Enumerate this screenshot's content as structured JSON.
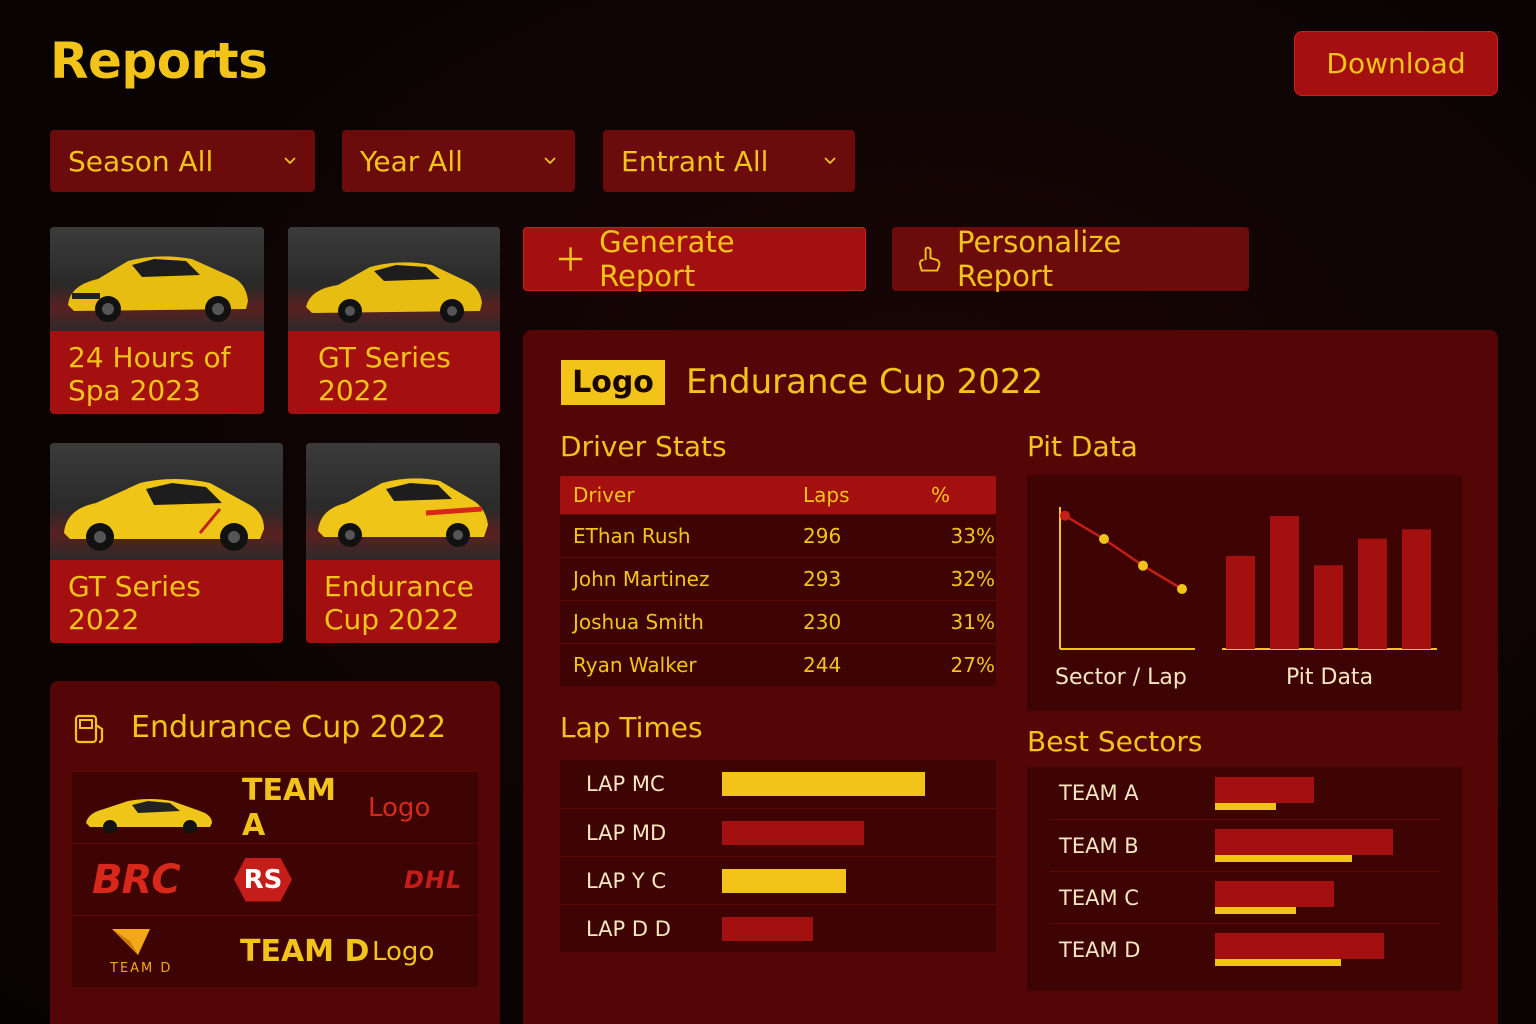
{
  "page": {
    "title": "Reports"
  },
  "header": {
    "download_label": "Download"
  },
  "filters": [
    {
      "label": "Season All"
    },
    {
      "label": "Year All"
    },
    {
      "label": "Entrant All"
    }
  ],
  "cards": [
    {
      "title": "24 Hours of Spa 2023"
    },
    {
      "title": "GT Series 2022"
    },
    {
      "title": "GT Series 2022"
    },
    {
      "title": "Endurance Cup 2022"
    }
  ],
  "actions": {
    "generate_label": "Generate Report",
    "personalize_label": "Personalize Report"
  },
  "report": {
    "logo_text": "Logo",
    "title": "Endurance Cup 2022",
    "driver_stats": {
      "heading": "Driver Stats",
      "columns": [
        "Driver",
        "Laps",
        "%"
      ],
      "rows": [
        {
          "driver": "EThan Rush",
          "laps": "296",
          "pct": "33%"
        },
        {
          "driver": "John Martinez",
          "laps": "293",
          "pct": "32%"
        },
        {
          "driver": "Joshua Smith",
          "laps": "230",
          "pct": "31%"
        },
        {
          "driver": "Ryan Walker",
          "laps": "244",
          "pct": "27%"
        }
      ]
    },
    "pit_data": {
      "heading": "Pit Data",
      "line_label": "Sector / Lap",
      "bar_label": "Pit Data",
      "line_values": [
        4,
        3.3,
        2.5,
        1.8
      ],
      "bar_values": [
        0.7,
        1.0,
        0.63,
        0.83,
        0.9
      ]
    },
    "lap_times": {
      "heading": "Lap Times",
      "rows": [
        {
          "label": "LAP MC",
          "value": 1.0,
          "color": "#f2c318"
        },
        {
          "label": "LAP MD",
          "value": 0.7,
          "color": "#a3100f"
        },
        {
          "label": "LAP Y C",
          "value": 0.61,
          "color": "#f2c318"
        },
        {
          "label": "LAP D D",
          "value": 0.45,
          "color": "#a3100f"
        }
      ]
    },
    "best_sectors": {
      "heading": "Best Sectors",
      "rows": [
        {
          "label": "TEAM A",
          "red": 0.55,
          "yellow": 0.34
        },
        {
          "label": "TEAM B",
          "red": 0.99,
          "yellow": 0.76
        },
        {
          "label": "TEAM C",
          "red": 0.66,
          "yellow": 0.45
        },
        {
          "label": "TEAM D",
          "red": 0.94,
          "yellow": 0.7
        }
      ]
    }
  },
  "entrants_panel": {
    "title": "Endurance Cup 2022",
    "team_a": "TEAM A",
    "team_a_logo": "Logo",
    "brc": "BRC",
    "rs": "RS",
    "dhl": "DHL",
    "team_d_mark": "TEAM D",
    "team_d": "TEAM D",
    "team_d_logo": "Logo"
  },
  "colors": {
    "accent": "#f2c318",
    "brand_red": "#a3100f",
    "panel": "#540606",
    "background": "#0b0303"
  }
}
